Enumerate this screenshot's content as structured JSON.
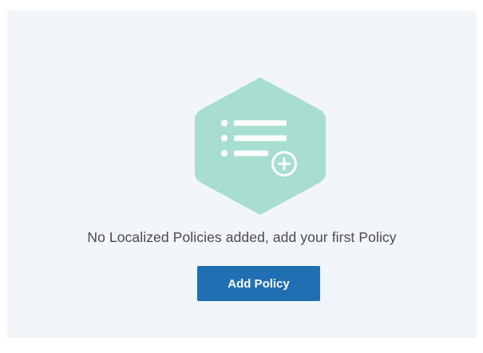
{
  "empty_state": {
    "message": "No Localized Policies added, add your first Policy",
    "icon": "list-add-icon",
    "add_button_label": "Add Policy"
  },
  "colors": {
    "hexagon": "#a8ddd2",
    "button": "#1f6fb2",
    "background": "#f2f5f9"
  }
}
